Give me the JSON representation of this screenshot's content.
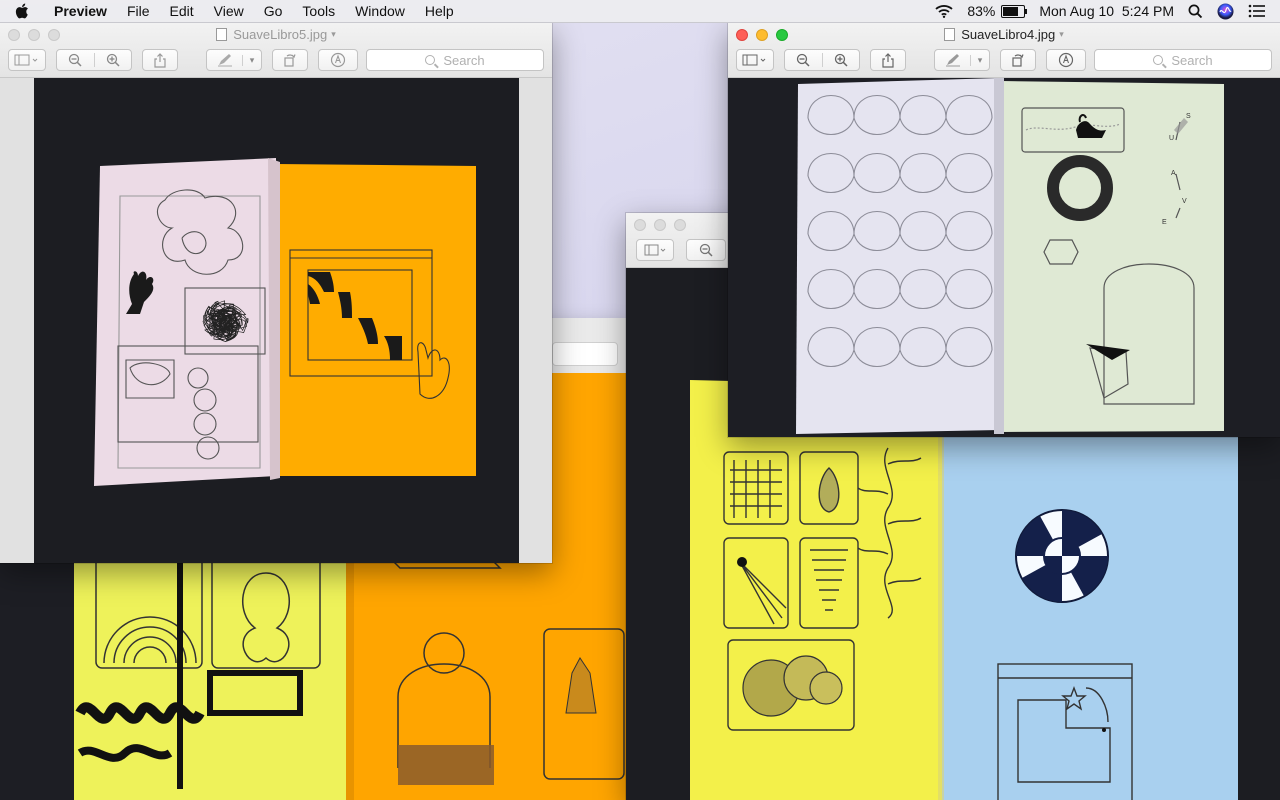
{
  "menubar": {
    "app_name": "Preview",
    "menus": [
      "File",
      "Edit",
      "View",
      "Go",
      "Tools",
      "Window",
      "Help"
    ],
    "battery_percent": "83%",
    "battery_level": 0.83,
    "datetime": "Mon Aug 10  5:24 PM"
  },
  "windows": {
    "front": {
      "title": "SuaveLibro4.jpg",
      "search_placeholder": "Search"
    },
    "left": {
      "title": "SuaveLibro5.jpg",
      "search_placeholder": "Search"
    }
  },
  "book_letters": [
    "S",
    "U",
    "A",
    "V",
    "E"
  ],
  "colors": {
    "orange": "#ffaa00",
    "yellow": "#f3f04a",
    "light_blue": "#a9d0ef",
    "pink_page": "#ecdbe6",
    "green_page": "#dfe9d4",
    "dark_bg": "#1d1e24",
    "close_red": "#fe5f57",
    "minimize_yellow": "#febc2e",
    "zoom_green": "#28c840"
  }
}
